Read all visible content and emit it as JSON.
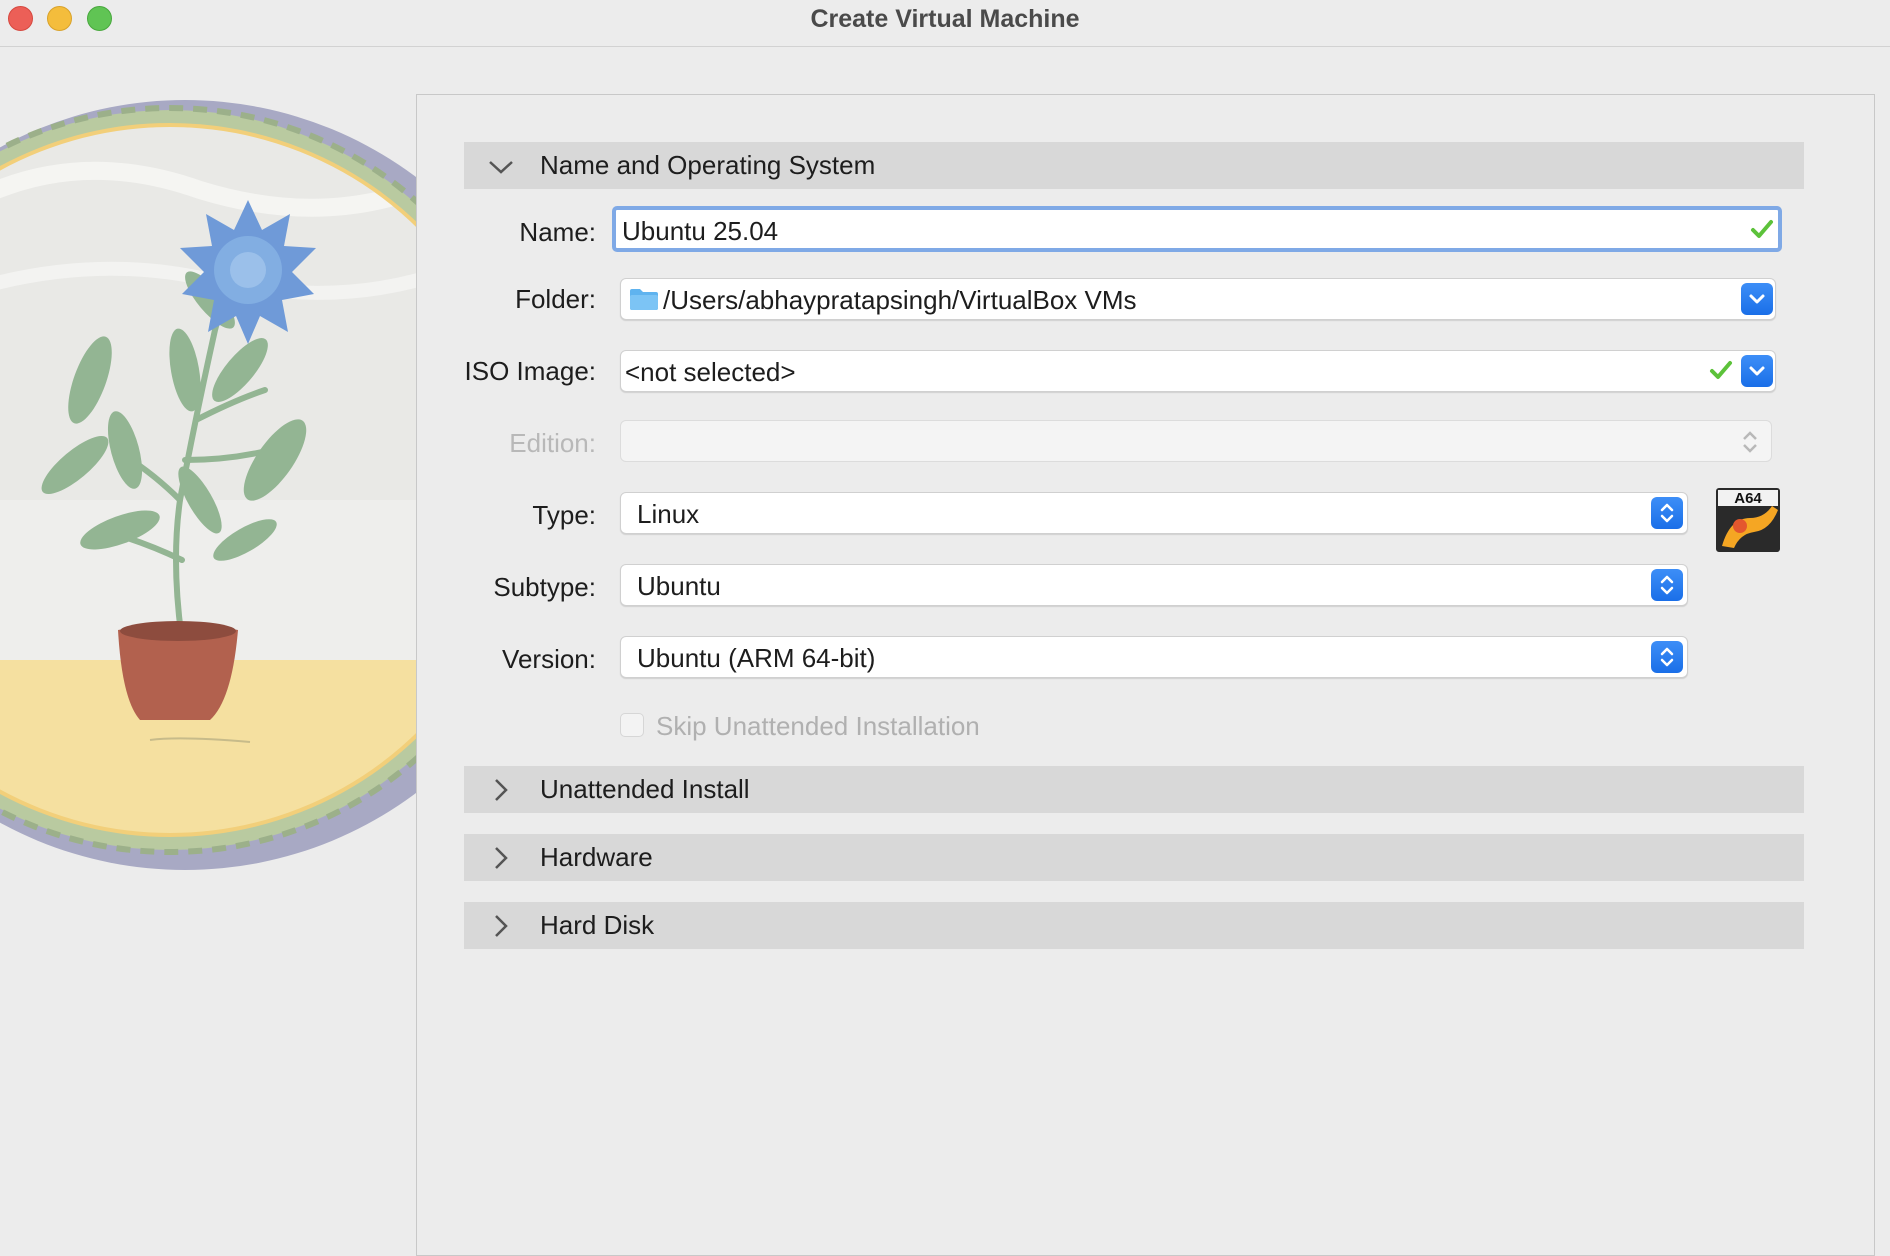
{
  "window": {
    "title": "Create Virtual Machine"
  },
  "sections": {
    "name_os": {
      "label": "Name and Operating System",
      "expanded": true
    },
    "unattended": {
      "label": "Unattended Install",
      "expanded": false
    },
    "hardware": {
      "label": "Hardware",
      "expanded": false
    },
    "hard_disk": {
      "label": "Hard Disk",
      "expanded": false
    }
  },
  "form": {
    "name": {
      "label": "Name:",
      "value": "Ubuntu 25.04"
    },
    "folder": {
      "label": "Folder:",
      "value": "/Users/abhaypratapsingh/VirtualBox VMs"
    },
    "iso": {
      "label": "ISO Image:",
      "value": "<not selected>"
    },
    "edition": {
      "label": "Edition:",
      "value": ""
    },
    "type": {
      "label": "Type:",
      "value": "Linux"
    },
    "subtype": {
      "label": "Subtype:",
      "value": "Ubuntu"
    },
    "version": {
      "label": "Version:",
      "value": "Ubuntu (ARM 64-bit)"
    },
    "skip_unattended": {
      "label": "Skip Unattended Installation",
      "checked": false
    }
  },
  "os_badge": {
    "text": "A64"
  },
  "colors": {
    "accent": "#1a6fe8",
    "focus_ring": "#7fa9e6",
    "valid_check": "#5cc23a",
    "section_bg": "#d8d8d8"
  }
}
